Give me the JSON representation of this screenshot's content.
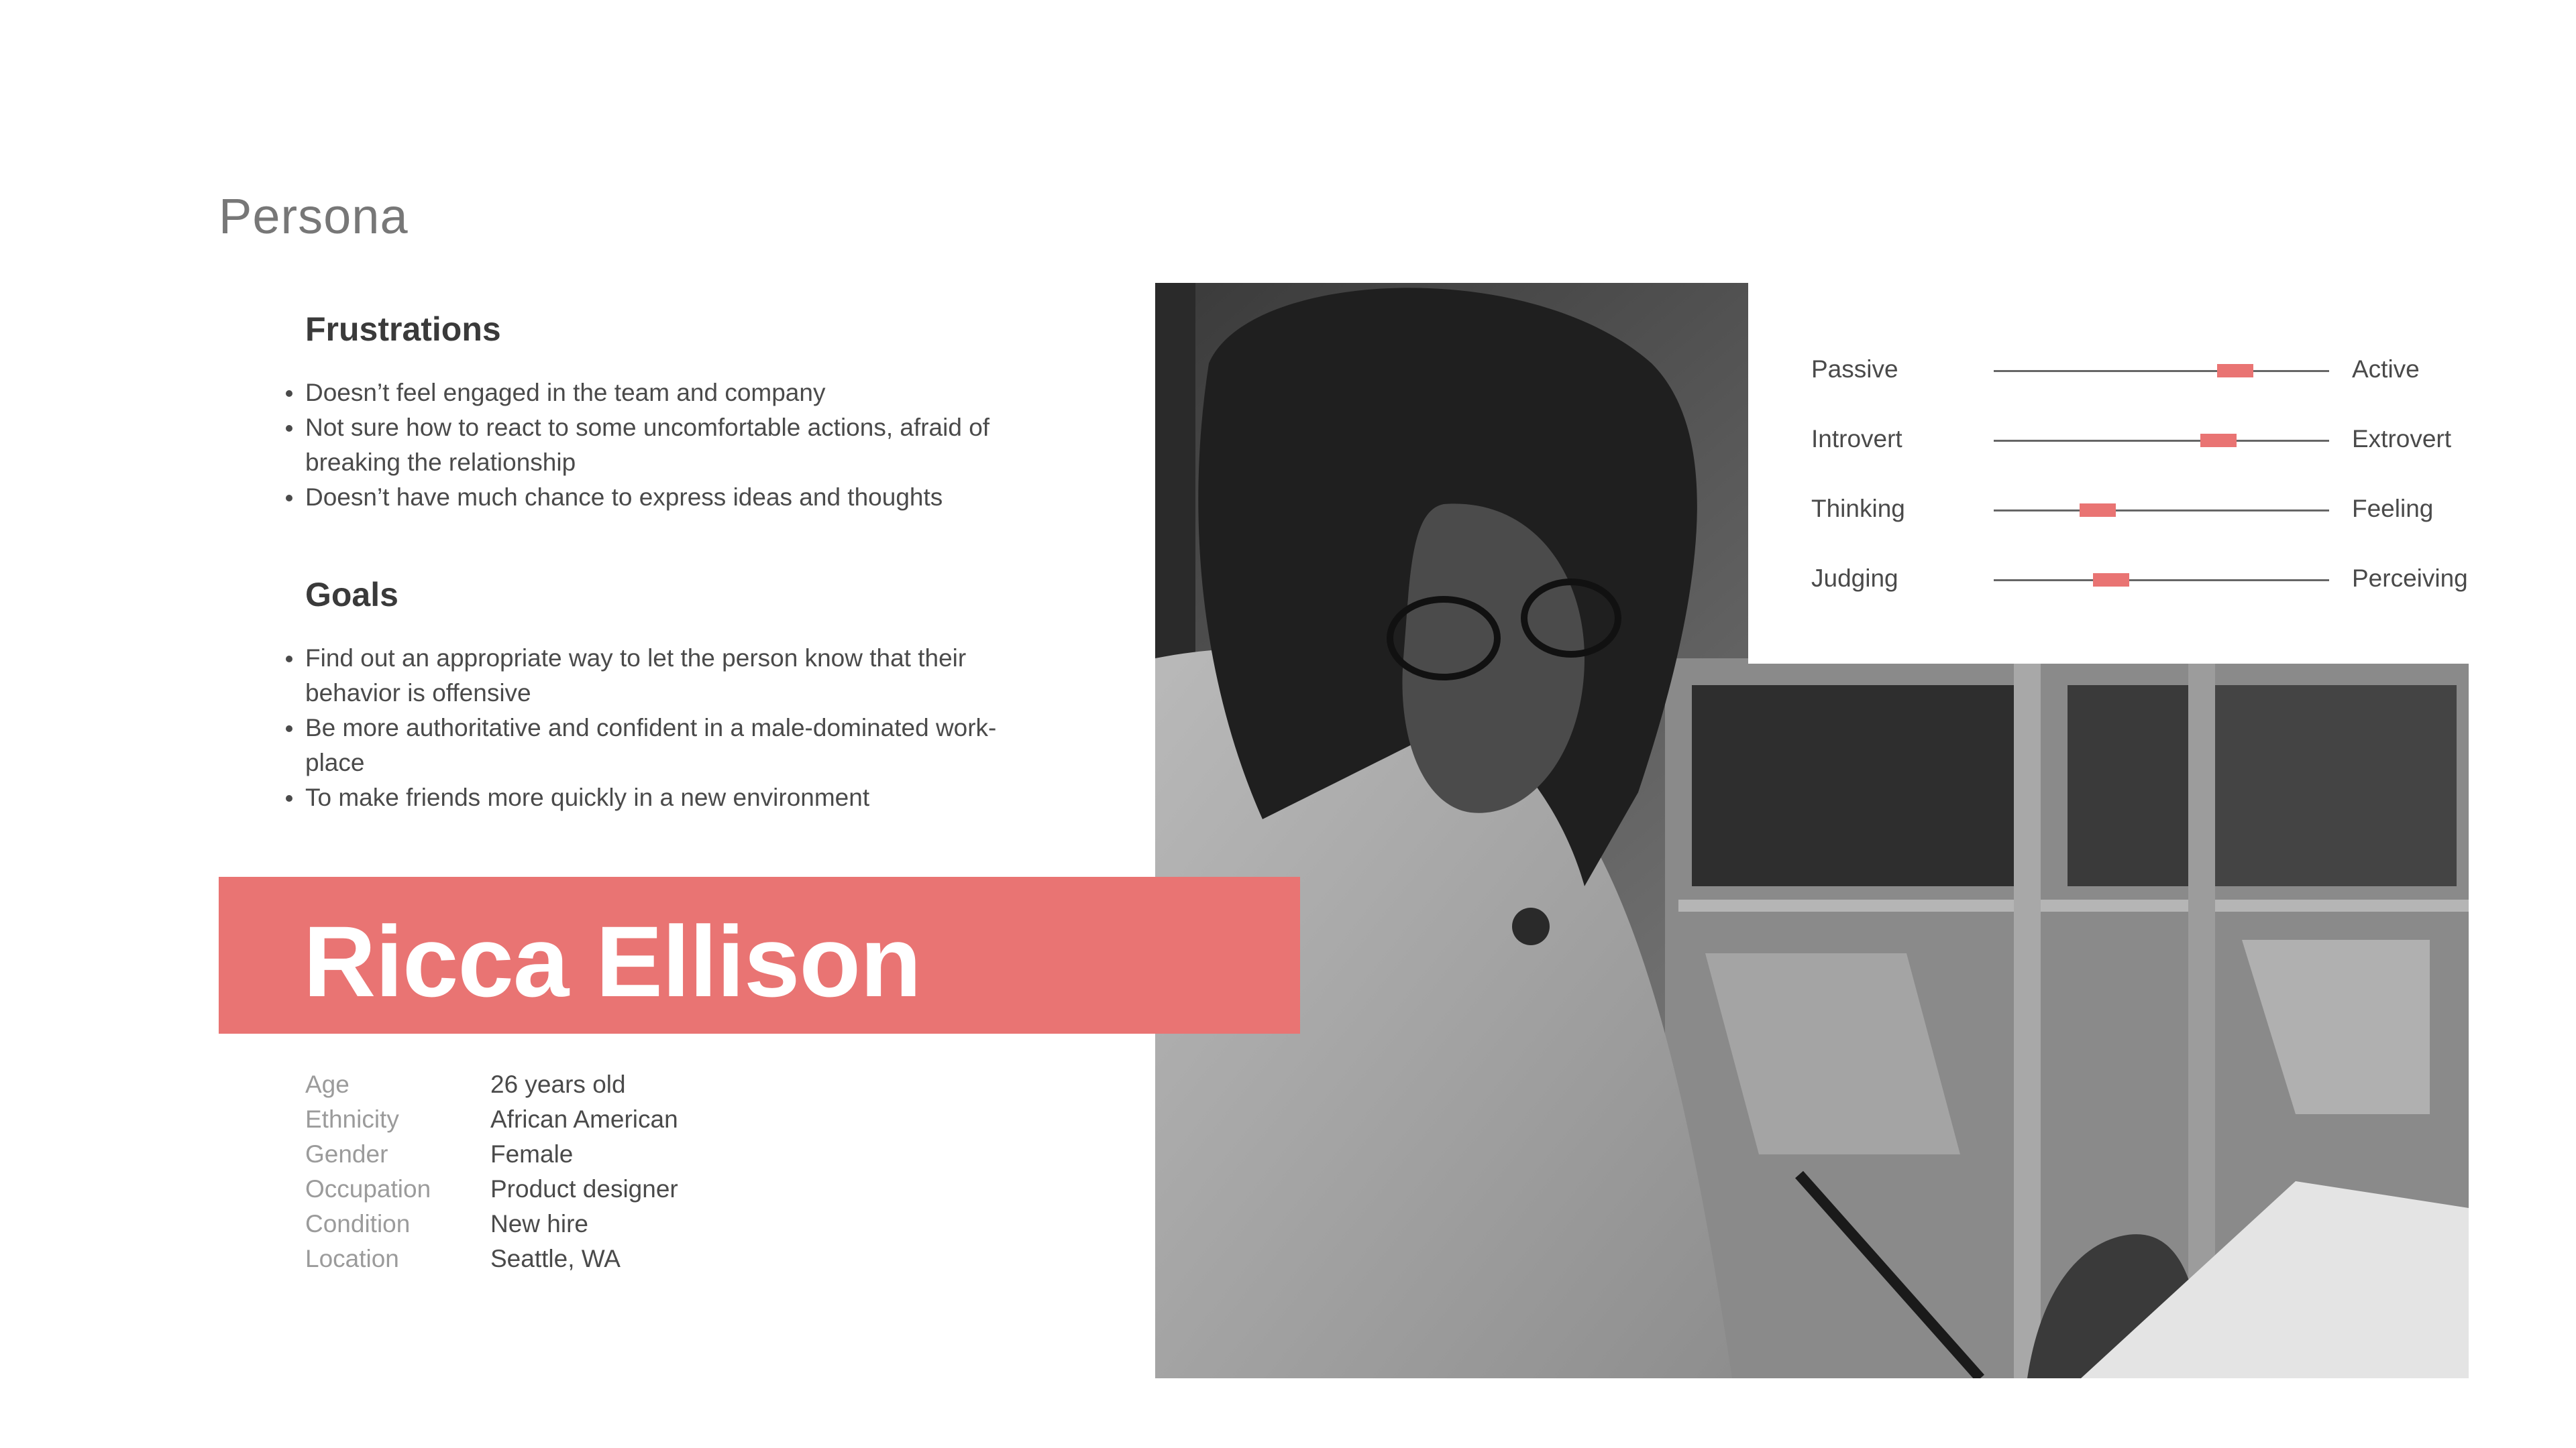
{
  "page_title": "Persona",
  "frustrations": {
    "heading": "Frustrations",
    "items": [
      "Doesn’t feel engaged in the team and company",
      "Not sure how to react to some uncomfortable actions, afraid of breaking the relationship",
      "Doesn’t have much chance to express ideas and thoughts"
    ]
  },
  "goals": {
    "heading": "Goals",
    "items": [
      "Find out an appropriate way to let the person know that their behavior is offensive",
      "Be more authoritative and confident in a male-dominated work-place",
      "To make friends more quickly in a new environment"
    ]
  },
  "persona": {
    "name": "Ricca Ellison",
    "accent_color": "#e97473",
    "details": [
      {
        "label": "Age",
        "value": "26 years old"
      },
      {
        "label": "Ethnicity",
        "value": "African American"
      },
      {
        "label": "Gender",
        "value": "Female"
      },
      {
        "label": "Occupation",
        "value": "Product designer"
      },
      {
        "label": "Condition",
        "value": "New hire"
      },
      {
        "label": "Location",
        "value": "Seattle, WA"
      }
    ]
  },
  "traits": [
    {
      "left": "Passive",
      "right": "Active",
      "level": 0.72
    },
    {
      "left": "Introvert",
      "right": "Extrovert",
      "level": 0.67
    },
    {
      "left": "Thinking",
      "right": "Feeling",
      "level": 0.31
    },
    {
      "left": "Judging",
      "right": "Perceiving",
      "level": 0.35
    }
  ]
}
